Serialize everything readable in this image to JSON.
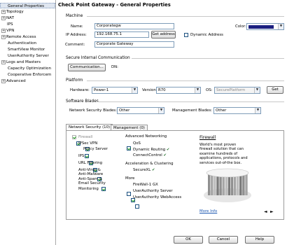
{
  "window": {
    "title": "Check Point Gateway - General Properties"
  },
  "tree": [
    {
      "label": "General Properties",
      "expander": "",
      "selected": true,
      "indent": 0
    },
    {
      "label": "Topology",
      "expander": "+",
      "selected": false,
      "indent": 0
    },
    {
      "label": "NAT",
      "expander": "+",
      "selected": false,
      "indent": 0
    },
    {
      "label": "IPS",
      "expander": "",
      "selected": false,
      "indent": 0
    },
    {
      "label": "VPN",
      "expander": "+",
      "selected": false,
      "indent": 0
    },
    {
      "label": "Remote Access",
      "expander": "+",
      "selected": false,
      "indent": 0
    },
    {
      "label": "Authentication",
      "expander": "",
      "selected": false,
      "indent": 1
    },
    {
      "label": "SmartView Monitor",
      "expander": "",
      "selected": false,
      "indent": 1
    },
    {
      "label": "UserAuthority Server",
      "expander": "",
      "selected": false,
      "indent": 1
    },
    {
      "label": "Logs and Masters",
      "expander": "+",
      "selected": false,
      "indent": 0
    },
    {
      "label": "Capacity Optimization",
      "expander": "",
      "selected": false,
      "indent": 1
    },
    {
      "label": "Cooperative Enforcem",
      "expander": "",
      "selected": false,
      "indent": 1
    },
    {
      "label": "Advanced",
      "expander": "+",
      "selected": false,
      "indent": 0
    }
  ],
  "machine": {
    "section_label": "Machine",
    "name_label": "Name:",
    "name_value": "Corporategw",
    "color_label": "Color:",
    "color_swatch": "#1b1f80",
    "ip_label": "IP Address:",
    "ip_value": "192.168.75.1",
    "get_address_button": "Get address",
    "dynamic_address_label": "Dynamic Address",
    "comment_label": "Comment:",
    "comment_value": "Corporate Gateway"
  },
  "sic": {
    "section_label": "Secure Internal Communication",
    "communication_button": "Communication...",
    "dn_label": "DN:"
  },
  "platform": {
    "section_label": "Platform",
    "hardware_label": "Hardware:",
    "hardware_value": "Power-1",
    "version_label": "Version:",
    "version_value": "R70",
    "os_label": "OS:",
    "os_value": "SecurePlatform",
    "get_button": "Get"
  },
  "blades": {
    "section_label": "Software Blades",
    "network_label": "Network Security Blades:",
    "network_value": "Other",
    "management_label": "Management Blades:",
    "management_value": "Other"
  },
  "tabs": [
    {
      "label": "Network Security (10)",
      "active": true
    },
    {
      "label": "Management (0)",
      "active": false
    }
  ],
  "col1": [
    {
      "label": "Firewall",
      "checked": true,
      "grayed": true,
      "indent": 0
    },
    {
      "label": "IPSec VPN",
      "checked": true,
      "grayed": false,
      "indent": 0
    },
    {
      "label": "Policy Server",
      "checked": true,
      "grayed": false,
      "indent": 1
    },
    {
      "label": "IPS",
      "checked": true,
      "grayed": false,
      "indent": 0
    },
    {
      "label": "URL Filtering",
      "checked": true,
      "grayed": false,
      "indent": 0
    },
    {
      "label": "Anti-Virus & Anti-Malware",
      "checked": true,
      "grayed": false,
      "indent": 0
    },
    {
      "label": "Anti-Spam & Email Security",
      "checked": true,
      "grayed": false,
      "indent": 0
    },
    {
      "label": "Monitoring",
      "checked": true,
      "grayed": false,
      "indent": 0
    }
  ],
  "col2": {
    "advanced_networking_label": "Advanced Networking",
    "qos": {
      "label": "QoS",
      "checked": true
    },
    "dynamic_routing": "Dynamic Routing",
    "connectcontrol": "ConnectControl",
    "acceleration_label": "Acceleration & Clustering",
    "securexl": "SecureXL",
    "more_label": "More",
    "more_items": [
      {
        "label": "FireWall-1 GX",
        "checked": false
      },
      {
        "label": "UserAuthority Server",
        "checked": true
      },
      {
        "label": "UserAuthority WebAccess",
        "checked": false
      }
    ]
  },
  "info": {
    "title": "Firewall",
    "description": "World's most proven firewall solution that can examine hundreds of applications, protocols and services out-of-the box.",
    "more_info": "More Info",
    "nav_prev": "◄",
    "nav_next": "►"
  },
  "footer": {
    "ok": "OK",
    "cancel": "Cancel",
    "help": "Help"
  }
}
